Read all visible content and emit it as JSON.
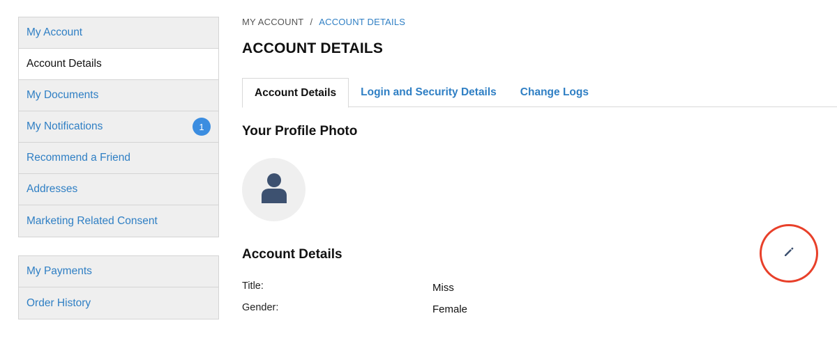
{
  "sidebar": {
    "group1": [
      {
        "label": "My Account",
        "active": false
      },
      {
        "label": "Account Details",
        "active": true
      },
      {
        "label": "My Documents",
        "active": false
      },
      {
        "label": "My Notifications",
        "active": false,
        "badge": "1"
      },
      {
        "label": "Recommend a Friend",
        "active": false
      },
      {
        "label": "Addresses",
        "active": false
      },
      {
        "label": "Marketing Related Consent",
        "active": false
      }
    ],
    "group2": [
      {
        "label": "My Payments",
        "active": false
      },
      {
        "label": "Order History",
        "active": false
      }
    ]
  },
  "breadcrumb": {
    "items": [
      "MY ACCOUNT",
      "ACCOUNT DETAILS"
    ],
    "separator": "/"
  },
  "page": {
    "title": "ACCOUNT DETAILS"
  },
  "tabs": [
    {
      "label": "Account Details",
      "active": true
    },
    {
      "label": "Login and Security Details",
      "active": false
    },
    {
      "label": "Change Logs",
      "active": false
    }
  ],
  "profile": {
    "title": "Your Profile Photo",
    "avatar_icon": "user-silhouette-icon"
  },
  "details": {
    "title": "Account Details",
    "edit_icon": "pencil-icon",
    "fields": [
      {
        "label": "Title:",
        "value": "Miss"
      },
      {
        "label": "Gender:",
        "value": "Female"
      }
    ]
  },
  "colors": {
    "link": "#2f7fc4",
    "badge": "#3b8de0",
    "highlight_ring": "#e8402a",
    "sidebar_bg": "#efefef",
    "icon_dark": "#3d5170"
  }
}
